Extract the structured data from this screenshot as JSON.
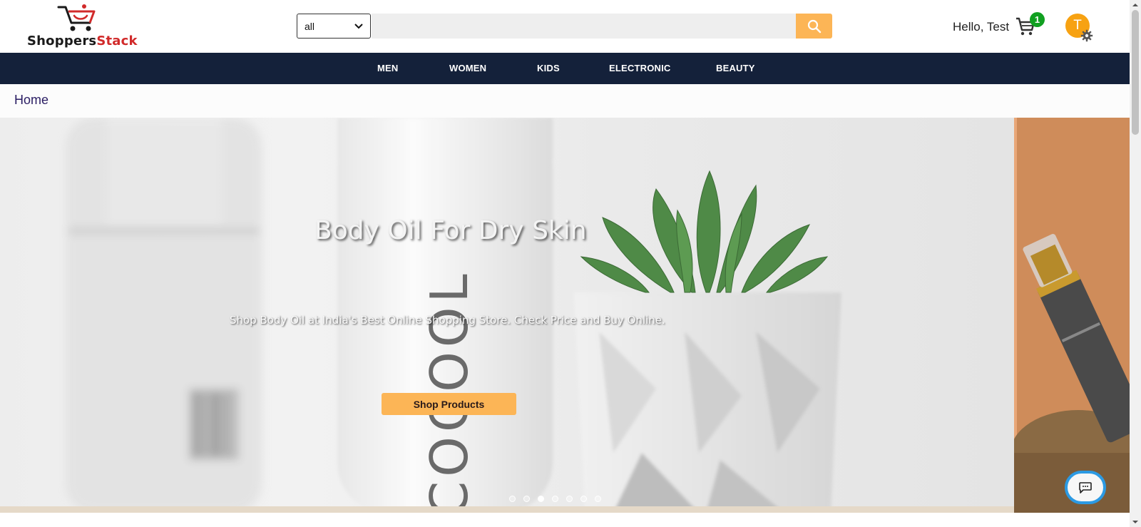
{
  "brand": {
    "name_part1": "Shoppers",
    "name_part2": "Stack"
  },
  "search": {
    "category_selected": "all",
    "input_value": "",
    "placeholder": ""
  },
  "user": {
    "greeting": "Hello, Test",
    "cart_count": "1",
    "avatar_initial": "T"
  },
  "nav": {
    "items": [
      "MEN",
      "WOMEN",
      "KIDS",
      "ELECTRONIC",
      "BEAUTY"
    ]
  },
  "breadcrumb": {
    "label": "Home"
  },
  "hero": {
    "title": "Body Oil For Dry Skin",
    "subtitle": "Shop Body Oil at India's Best Online Shopping Store. Check Price and Buy Online.",
    "bottle_text": "COCOOL",
    "cta_label": "Shop Products",
    "slide_count": 7,
    "active_slide": 3
  },
  "colors": {
    "accent": "#fcb556",
    "nav_bg": "#14213a",
    "badge": "#11a021",
    "avatar": "#f7a212",
    "brand_red": "#d12a2a",
    "chat_ring": "#2c9ae3"
  },
  "icons": {
    "logo": "shopping-cart-logo-icon",
    "search": "search-icon",
    "cart": "cart-icon",
    "settings": "gear-icon",
    "chat": "chat-icon"
  }
}
